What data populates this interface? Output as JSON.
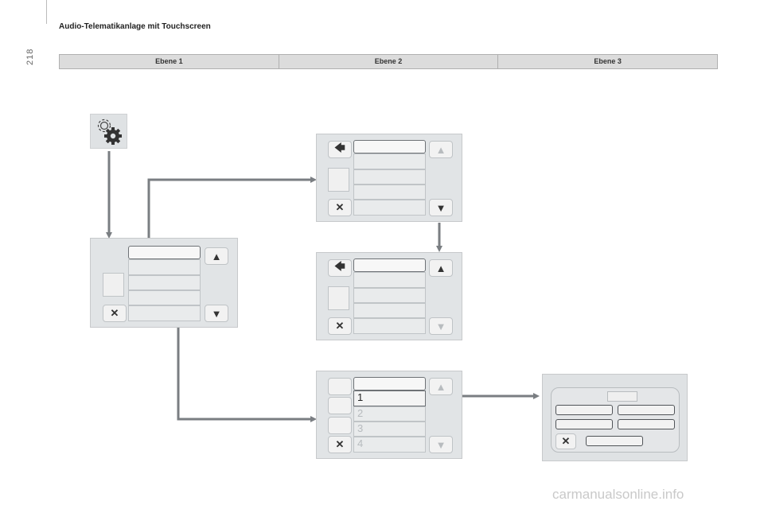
{
  "page_number": "218",
  "doc_title": "Audio-Telematikanlage mit Touchscreen",
  "columns": [
    "Ebene 1",
    "Ebene 2",
    "Ebene 3"
  ],
  "list_numbers": [
    "1",
    "2",
    "3",
    "4"
  ],
  "watermark": "carmanualsonline.info",
  "icons": {
    "settings": "gears-icon",
    "back": "back-arrow-icon",
    "up": "triangle-up-icon",
    "down": "triangle-down-icon",
    "close": "close-x-icon"
  },
  "colors": {
    "panel": "#e1e4e6",
    "arrow": "#7a7e82",
    "header_bar": "#dcdcdc"
  }
}
